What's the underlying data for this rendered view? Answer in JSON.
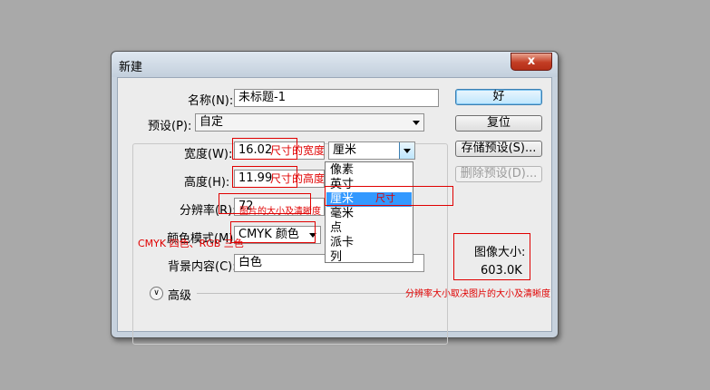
{
  "dialog": {
    "title": "新建",
    "close_glyph": "x"
  },
  "form": {
    "name_label": "名称(N):",
    "name_value": "未标题-1",
    "preset_label": "预设(P):",
    "preset_value": "自定",
    "width_label": "宽度(W):",
    "width_value": "16.02",
    "height_label": "高度(H):",
    "height_value": "11.99",
    "resolution_label": "分辨率(R):",
    "resolution_value": "72",
    "color_mode_label": "颜色模式(M):",
    "color_mode_value": "CMYK 颜色",
    "background_label": "背景内容(C):",
    "background_value": "白色",
    "advanced_label": "高级",
    "unit_selected": "厘米"
  },
  "unit_dropdown": {
    "items": [
      "像素",
      "英寸",
      "厘米",
      "毫米",
      "点",
      "派卡",
      "列"
    ],
    "selected_index": 2
  },
  "buttons": {
    "ok": "好",
    "reset": "复位",
    "save_preset": "存储预设(S)...",
    "delete_preset": "删除预设(D)..."
  },
  "image_size": {
    "label": "图像大小:",
    "value": "603.0K"
  },
  "annotations": {
    "width_note": "尺寸的宽度",
    "height_note": "尺寸的高度",
    "resolution_note": "图片的大小及清晰度",
    "color_note": "CMYK 四色、RGB 三色",
    "unit_note": "尺寸",
    "size_note": "分辨率大小取决图片的大小及清晰度"
  },
  "colors": {
    "annotation_red": "#e00000",
    "selection_blue": "#3399ff",
    "close_red": "#c23d24"
  }
}
